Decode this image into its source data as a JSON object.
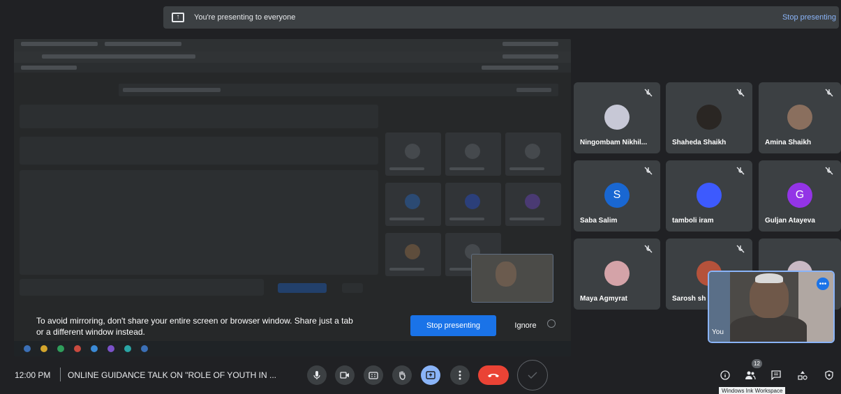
{
  "banner": {
    "text": "You're presenting to everyone",
    "stop_label": "Stop presenting"
  },
  "mirror_warning": {
    "line1": "To avoid mirroring, don't share your entire screen or browser window. Share just a tab",
    "line2": "or a different window instead.",
    "stop_label": "Stop presenting",
    "ignore_label": "Ignore"
  },
  "participants": [
    {
      "name": "Ningombam Nikhil...",
      "initial": "",
      "color": "#c7c8d6"
    },
    {
      "name": "Shaheda Shaikh",
      "initial": "",
      "color": "#2a2623"
    },
    {
      "name": "Amina Shaikh",
      "initial": "",
      "color": "#8a6f5e"
    },
    {
      "name": "Saba Salim",
      "initial": "S",
      "color": "#1967d2"
    },
    {
      "name": "tamboli iram",
      "initial": "",
      "color": "#3d5afe"
    },
    {
      "name": "Guljan Atayeva",
      "initial": "G",
      "color": "#9334e6"
    },
    {
      "name": "Maya Agmyrat",
      "initial": "",
      "color": "#d4a3a8"
    },
    {
      "name": "Sarosh sh",
      "initial": "",
      "color": "#b5523b"
    },
    {
      "name": "",
      "initial": "",
      "color": "#c9b9c4"
    }
  ],
  "self_view": {
    "label": "You",
    "more_icon": "more-horiz-icon"
  },
  "bottom_bar": {
    "time": "12:00 PM",
    "meeting_title": "ONLINE GUIDANCE TALK ON \"ROLE OF YOUTH IN ...",
    "people_count": "12",
    "tooltip": "Windows Ink Workspace"
  },
  "colors": {
    "accent": "#1a73e8",
    "link": "#8ab4f8",
    "end_call": "#ea4335",
    "background": "#202124",
    "tile": "#3c4043"
  }
}
